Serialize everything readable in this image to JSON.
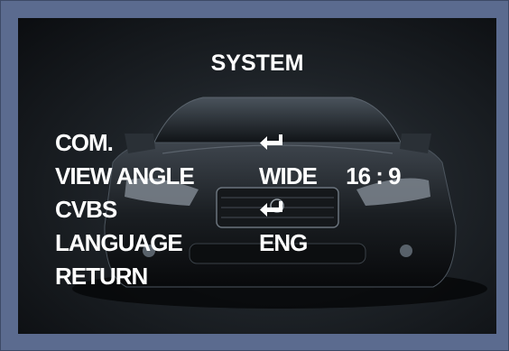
{
  "menu": {
    "title": "SYSTEM",
    "items": [
      {
        "label": "COM.",
        "icon": "enter-return-icon"
      },
      {
        "label": "VIEW ANGLE",
        "value": "WIDE",
        "value2": "16 : 9"
      },
      {
        "label": "CVBS",
        "icon": "enter-return-icon"
      },
      {
        "label": "LANGUAGE",
        "value": "ENG"
      },
      {
        "label": "RETURN"
      }
    ]
  },
  "colors": {
    "frame": "#5b6b8f",
    "screen_background": "#1e2328",
    "text": "#ffffff"
  }
}
